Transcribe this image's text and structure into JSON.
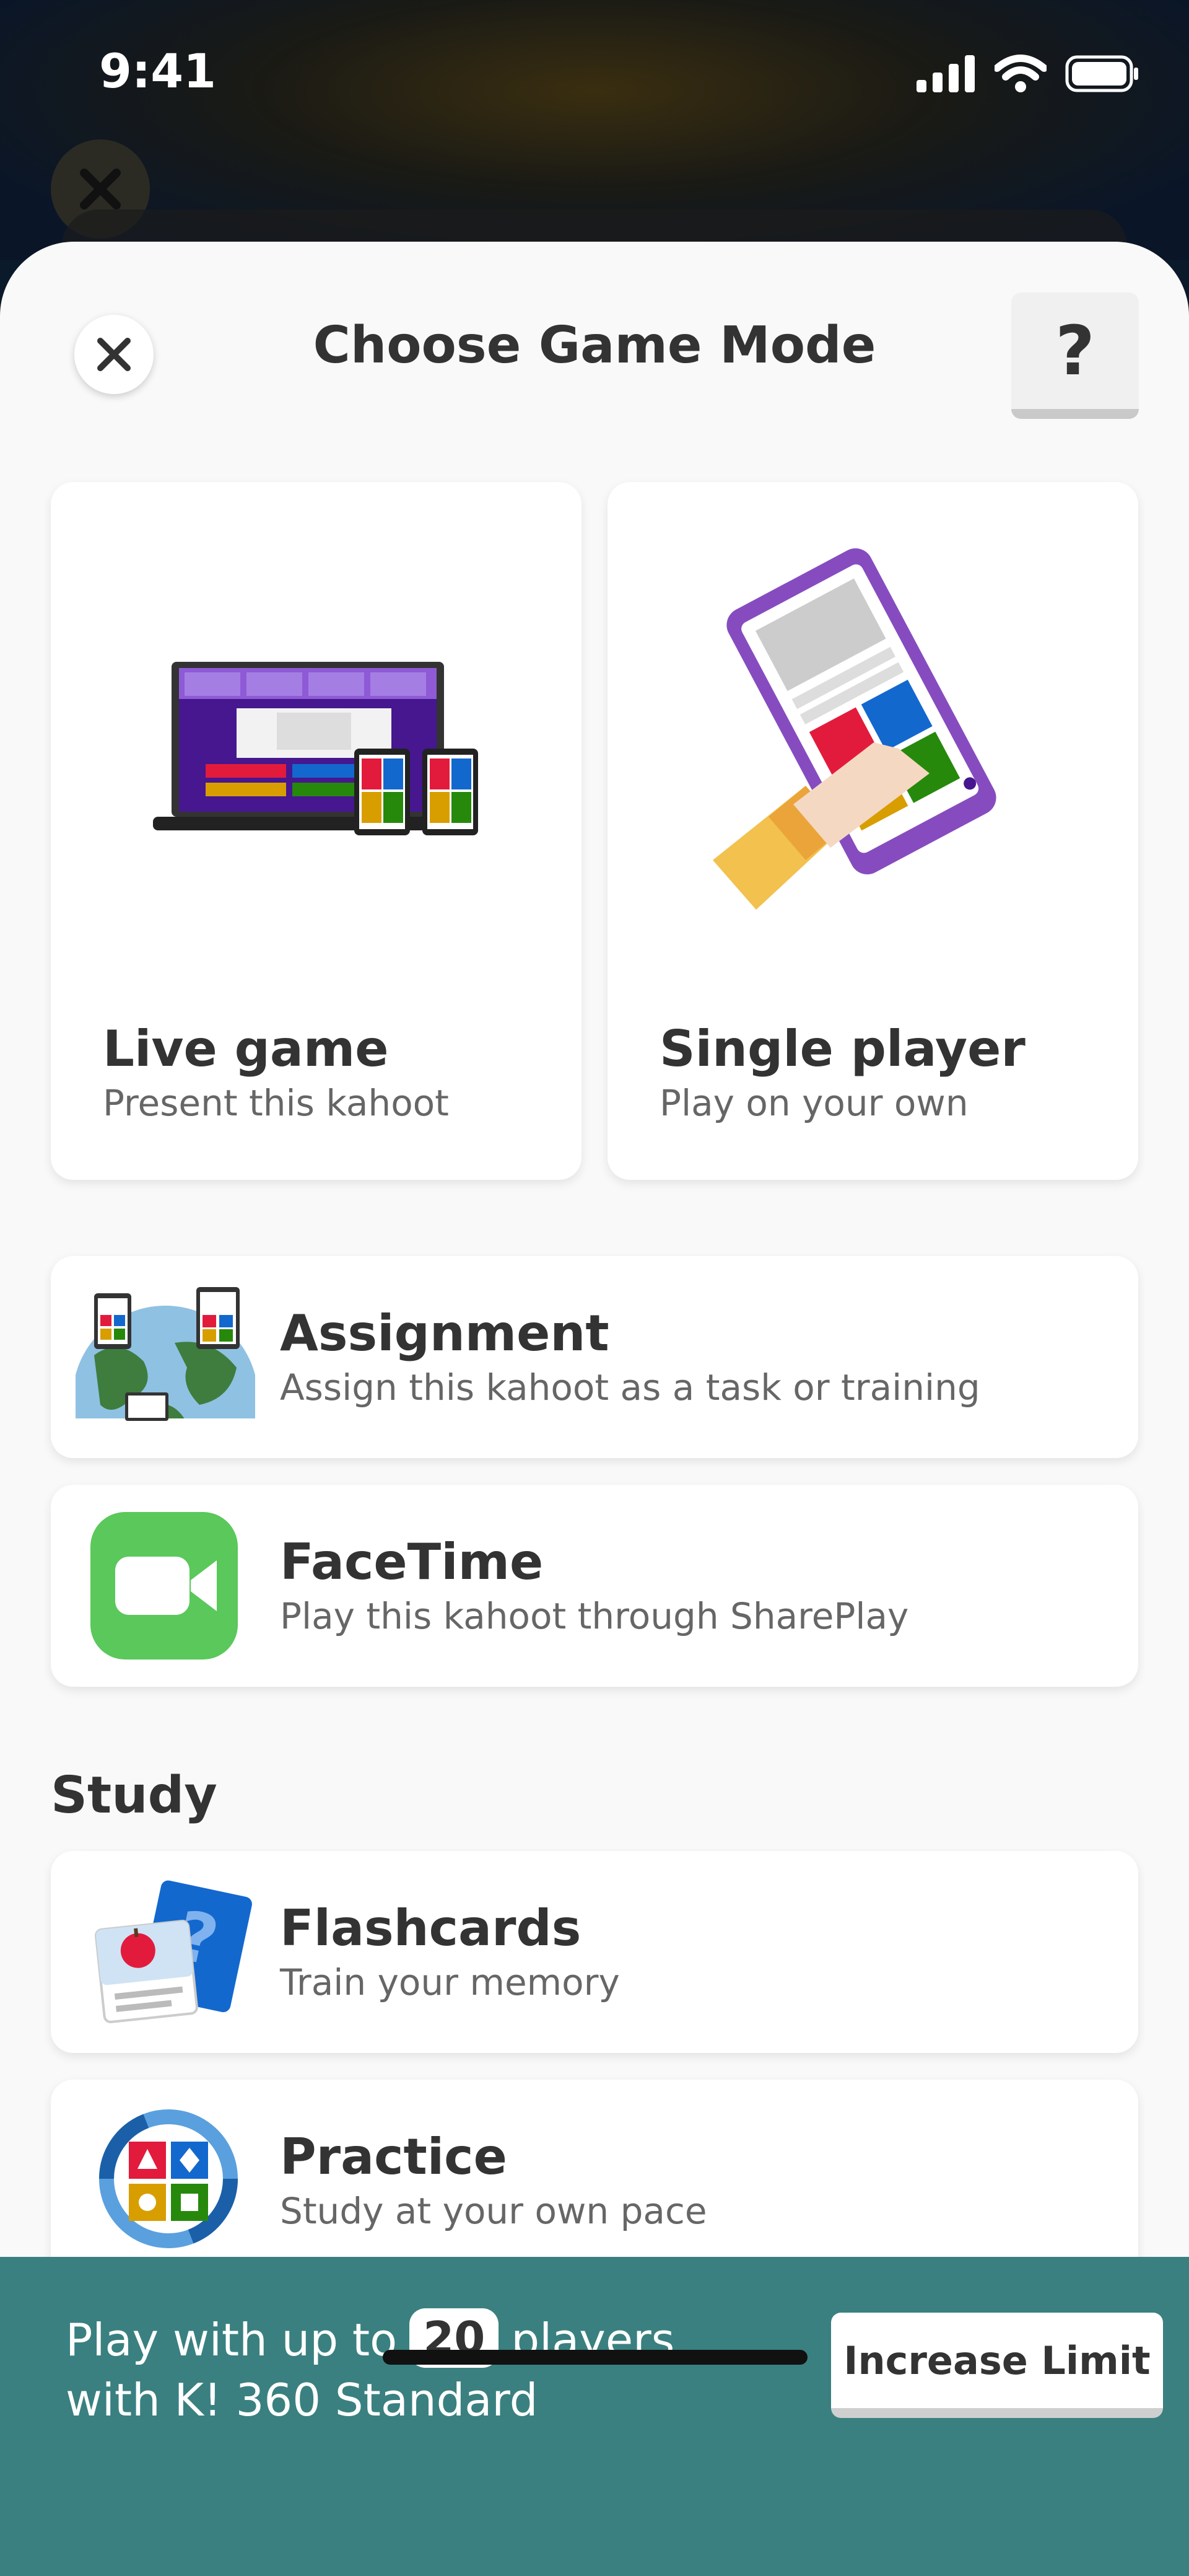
{
  "status_bar": {
    "time": "9:41"
  },
  "header": {
    "title": "Choose Game Mode",
    "help_label": "?"
  },
  "modes": [
    {
      "title": "Live game",
      "subtitle": "Present this kahoot"
    },
    {
      "title": "Single player",
      "subtitle": "Play on your own"
    }
  ],
  "options": [
    {
      "title": "Assignment",
      "subtitle": "Assign this kahoot as a task or training"
    },
    {
      "title": "FaceTime",
      "subtitle": "Play this kahoot through SharePlay"
    }
  ],
  "study": {
    "heading": "Study",
    "items": [
      {
        "title": "Flashcards",
        "subtitle": "Train your memory"
      },
      {
        "title": "Practice",
        "subtitle": "Study at your own pace"
      }
    ]
  },
  "banner": {
    "text_before": "Play with up to",
    "player_limit": "20",
    "text_after": "players",
    "line2": "with K! 360 Standard",
    "button_label": "Increase Limit"
  },
  "colors": {
    "kahoot_purple": "#6c3fb2",
    "banner_teal": "#3a8080",
    "facetime_green": "#5ac85a",
    "red": "#e21b3c",
    "blue": "#1368ce",
    "yellow": "#d89e00",
    "green": "#26890c"
  }
}
